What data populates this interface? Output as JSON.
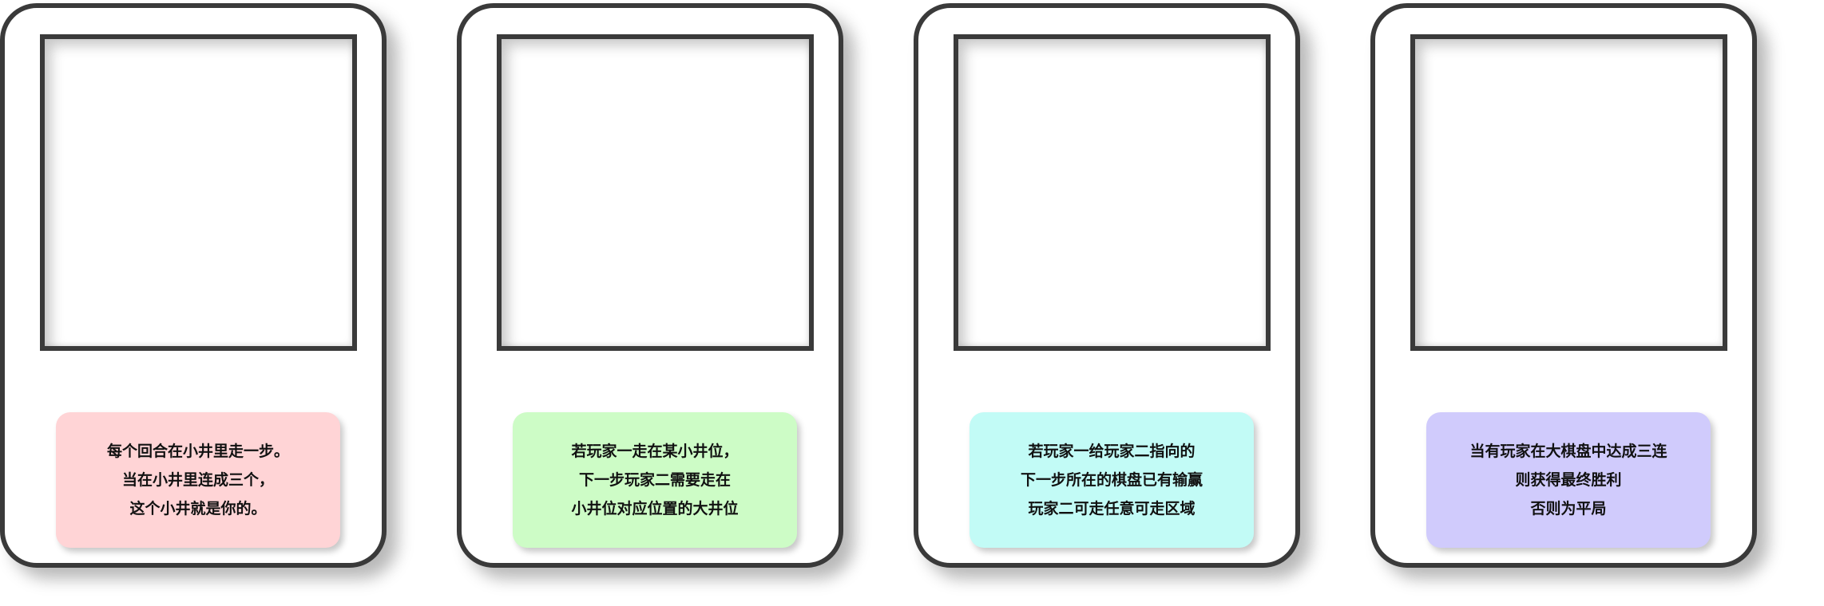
{
  "cards": [
    {
      "note_color": "#ffd4d6",
      "lines": [
        "每个回合在小井里走一步。",
        "当在小井里连成三个，",
        "这个小井就是你的。"
      ]
    },
    {
      "note_color": "#cdfcc6",
      "lines": [
        "若玩家一走在某小井位，",
        "下一步玩家二需要走在",
        "小井位对应位置的大井位"
      ]
    },
    {
      "note_color": "#c2fbf6",
      "lines": [
        "若玩家一给玩家二指向的",
        "下一步所在的棋盘已有输赢",
        "玩家二可走任意可走区域"
      ]
    },
    {
      "note_color": "#d0cbfc",
      "lines": [
        "当有玩家在大棋盘中达成三连",
        "则获得最终胜利",
        "否则为平局"
      ]
    }
  ]
}
